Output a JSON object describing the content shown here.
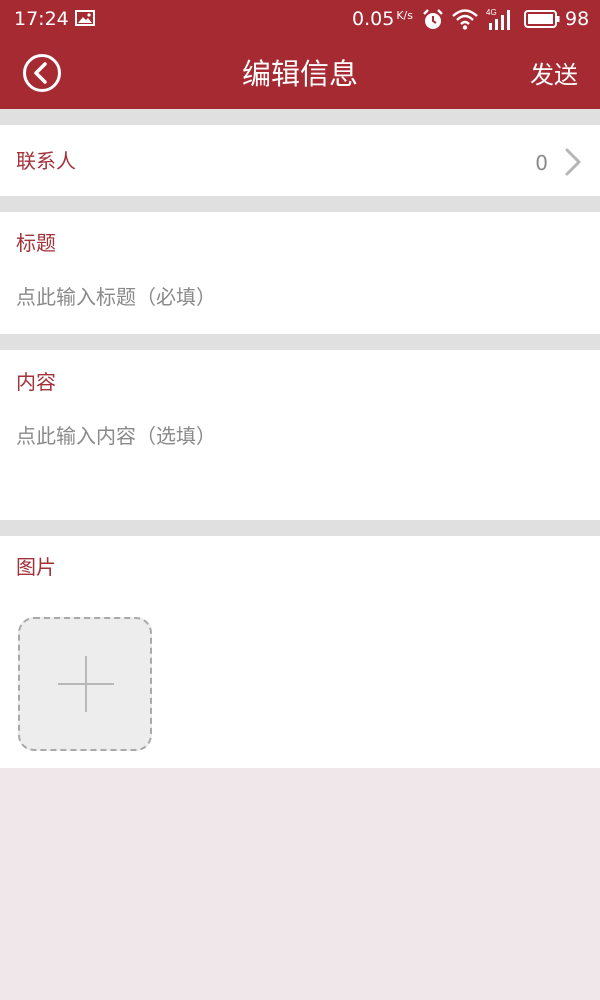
{
  "status_bar": {
    "time": "17:24",
    "network_speed": "0.05",
    "network_speed_unit": "K/s",
    "network_type": "4G",
    "battery": "98",
    "icons": [
      "image-icon",
      "alarm-icon",
      "wifi-icon",
      "signal-4g-icon",
      "battery-icon"
    ]
  },
  "header": {
    "title": "编辑信息",
    "send_label": "发送",
    "back_icon": "back-circle-icon"
  },
  "contacts": {
    "label": "联系人",
    "count": "0"
  },
  "title_field": {
    "label": "标题",
    "placeholder": "点此输入标题（必填）"
  },
  "content_field": {
    "label": "内容",
    "placeholder": "点此输入内容（选填）"
  },
  "images": {
    "label": "图片",
    "add_icon": "plus-icon"
  },
  "colors": {
    "accent": "#a62a32",
    "label": "#a3323a",
    "placeholder": "#8a8a8a",
    "divider": "#e1e0e0",
    "background": "#efe7e9"
  }
}
